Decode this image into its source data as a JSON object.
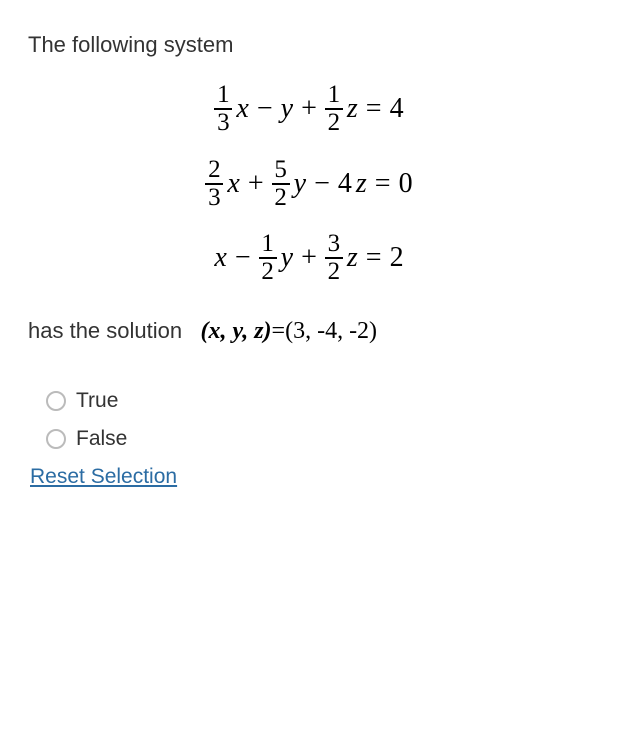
{
  "prompt": {
    "intro": "The following system",
    "solution_prefix": "has the solution",
    "solution_vars": "(x, y, z)",
    "solution_eq": "=(3, -4, -2)"
  },
  "equations": {
    "eq1": {
      "f1_num": "1",
      "f1_den": "3",
      "v1": "x",
      "op1": "−",
      "v2": "y",
      "op2": "+",
      "f2_num": "1",
      "f2_den": "2",
      "v3": "z",
      "eq": "=",
      "rhs": "4"
    },
    "eq2": {
      "f1_num": "2",
      "f1_den": "3",
      "v1": "x",
      "op1": "+",
      "f2_num": "5",
      "f2_den": "2",
      "v2": "y",
      "op2": "−",
      "c3": "4",
      "v3": "z",
      "eq": "=",
      "rhs": "0"
    },
    "eq3": {
      "v1": "x",
      "op1": "−",
      "f1_num": "1",
      "f1_den": "2",
      "v2": "y",
      "op2": "+",
      "f2_num": "3",
      "f2_den": "2",
      "v3": "z",
      "eq": "=",
      "rhs": "2"
    }
  },
  "options": {
    "true_label": "True",
    "false_label": "False"
  },
  "actions": {
    "reset": "Reset Selection"
  }
}
